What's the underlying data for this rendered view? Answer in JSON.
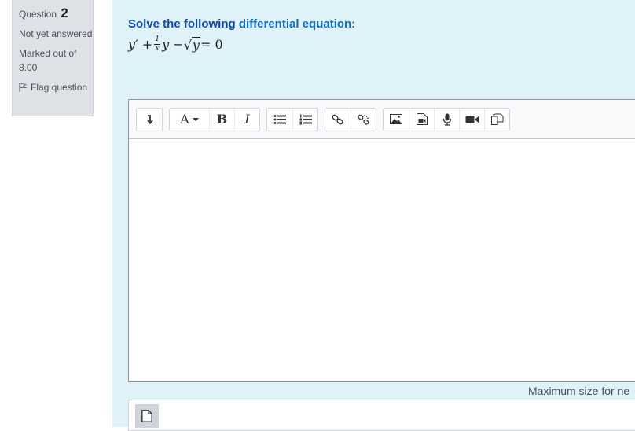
{
  "info": {
    "question_label": "Question",
    "question_number": "2",
    "state": "Not yet answered",
    "grade": "Marked out of 8.00",
    "flag_label": "Flag question"
  },
  "question": {
    "text_part1": "Solve the following ",
    "text_highlight": "differential equation:",
    "formula": {
      "lhs_start": "y′ + ",
      "frac_num": "1",
      "frac_den": "x",
      "mid": "y − ",
      "radicand": "y",
      "rhs": " = 0"
    }
  },
  "toolbar": {
    "font_size_label": "A",
    "bold_label": "B",
    "italic_label": "I",
    "icons": [
      "collapse-icon",
      "font-size-icon",
      "bold-icon",
      "italic-icon",
      "unordered-list-icon",
      "ordered-list-icon",
      "link-icon",
      "unlink-icon",
      "image-icon",
      "media-icon",
      "microphone-icon",
      "video-icon",
      "manage-files-icon"
    ]
  },
  "files": {
    "max_size_label": "Maximum size for ne"
  },
  "colors": {
    "content_bg": "#def2f8",
    "info_bg": "#dee2e6",
    "question_text": "#0f47ad"
  }
}
